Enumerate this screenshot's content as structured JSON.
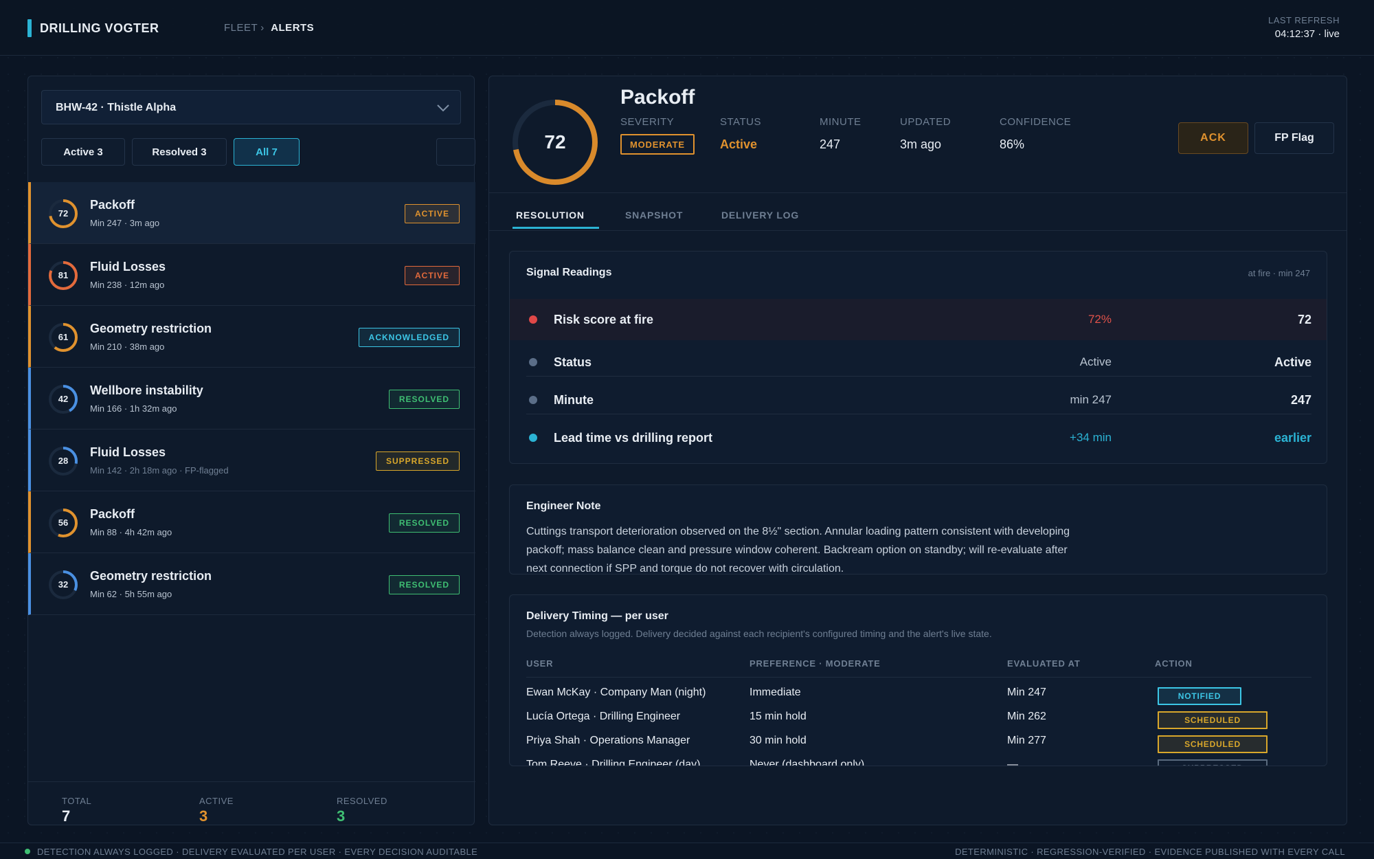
{
  "header": {
    "brand": "DRILLING VOGTER",
    "breadcrumb_parent": "FLEET",
    "breadcrumb_sep": "›",
    "breadcrumb_current": "ALERTS",
    "refresh_label": "LAST REFRESH",
    "refresh_value": "04:12:37 · live"
  },
  "sidebar": {
    "well": "BHW-42 · Thistle Alpha",
    "filters": [
      "Active 3",
      "Resolved 3",
      "All 7"
    ],
    "alerts": [
      {
        "score": "72",
        "title": "Packoff",
        "sub": "Min 247 · 3m ago",
        "status": "ACTIVE"
      },
      {
        "score": "81",
        "title": "Fluid Losses",
        "sub": "Min 238 · 12m ago",
        "status": "ACTIVE"
      },
      {
        "score": "61",
        "title": "Geometry restriction",
        "sub": "Min 210 · 38m ago",
        "status": "ACKNOWLEDGED"
      },
      {
        "score": "42",
        "title": "Wellbore instability",
        "sub": "Min 166 · 1h 32m ago",
        "status": "RESOLVED"
      },
      {
        "score": "28",
        "title": "Fluid Losses",
        "sub": "Min 142 · 2h 18m ago · FP-flagged",
        "status": "SUPPRESSED"
      },
      {
        "score": "56",
        "title": "Packoff",
        "sub": "Min 88 · 4h 42m ago",
        "status": "RESOLVED"
      },
      {
        "score": "32",
        "title": "Geometry restriction",
        "sub": "Min 62 · 5h 55m ago",
        "status": "RESOLVED"
      }
    ],
    "totals": {
      "total_label": "TOTAL",
      "total": "7",
      "active_label": "ACTIVE",
      "active": "3",
      "resolved_label": "RESOLVED",
      "resolved": "3"
    }
  },
  "detail": {
    "score": "72",
    "title": "Packoff",
    "severity_label": "SEVERITY",
    "severity": "MODERATE",
    "status_label": "STATUS",
    "status": "Active",
    "minute_label": "MINUTE",
    "minute": "247",
    "updated_label": "UPDATED",
    "updated": "3m ago",
    "confidence_label": "CONFIDENCE",
    "confidence": "86%",
    "ack_button": "ACK",
    "fp_button": "FP Flag",
    "tabs": [
      "RESOLUTION",
      "SNAPSHOT",
      "DELIVERY LOG"
    ],
    "signals": {
      "title": "Signal Readings",
      "context": "at fire · min 247",
      "rows": [
        {
          "label": "Risk score at fire",
          "mid": "72%",
          "end": "72"
        },
        {
          "label": "Status",
          "mid": "Active",
          "end": "Active"
        },
        {
          "label": "Minute",
          "mid": "min 247",
          "end": "247"
        },
        {
          "label": "Lead time vs drilling report",
          "mid": "+34 min",
          "end": "earlier"
        }
      ]
    },
    "note": {
      "title": "Engineer Note",
      "text": "Cuttings transport deterioration observed on the 8½\" section. Annular loading pattern consistent with developing packoff; mass balance clean and pressure window coherent. Backream option on standby; will re-evaluate after next connection if SPP and torque do not recover with circulation."
    },
    "delivery": {
      "title": "Delivery Timing — per user",
      "subtitle": "Detection always logged. Delivery decided against each recipient's configured timing and the alert's live state.",
      "columns": [
        "USER",
        "PREFERENCE · MODERATE",
        "EVALUATED AT",
        "ACTION"
      ],
      "rows": [
        {
          "user": "Ewan McKay · Company Man (night)",
          "pref": "Immediate",
          "at": "Min 247",
          "action": "NOTIFIED"
        },
        {
          "user": "Lucía Ortega · Drilling Engineer",
          "pref": "15 min hold",
          "at": "Min 262",
          "action": "SCHEDULED"
        },
        {
          "user": "Priya Shah · Operations Manager",
          "pref": "30 min hold",
          "at": "Min 277",
          "action": "SCHEDULED"
        },
        {
          "user": "Tom Reeve · Drilling Engineer (day)",
          "pref": "Never (dashboard only)",
          "at": "—",
          "action": "SUPPRESSED"
        }
      ]
    }
  },
  "footer": {
    "left": "DETECTION ALWAYS LOGGED · DELIVERY EVALUATED PER USER · EVERY DECISION AUDITABLE",
    "right": "DETERMINISTIC · REGRESSION-VERIFIED · EVIDENCE PUBLISHED WITH EVERY CALL"
  },
  "colors": {
    "accent": "#2bb3d4",
    "orange": "#e0922e",
    "red": "#e36a3c",
    "blue": "#4a90e2",
    "green": "#3fbf73",
    "amber": "#d9a72b"
  }
}
